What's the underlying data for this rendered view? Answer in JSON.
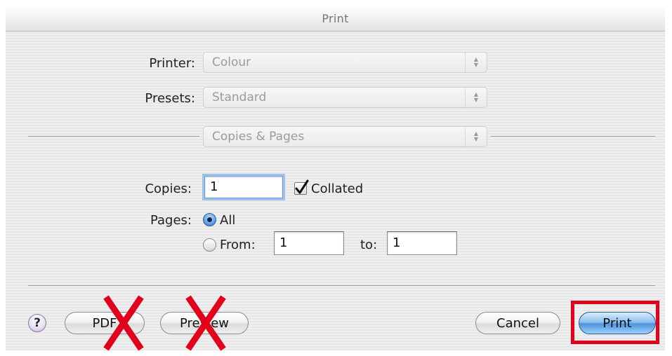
{
  "dialog": {
    "title": "Print"
  },
  "printer": {
    "label": "Printer:",
    "value": "Colour"
  },
  "presets": {
    "label": "Presets:",
    "value": "Standard"
  },
  "panel_selector": {
    "value": "Copies & Pages"
  },
  "copies": {
    "label": "Copies:",
    "value": "1",
    "collated_label": "Collated",
    "collated_checked": true
  },
  "pages": {
    "label": "Pages:",
    "all_label": "All",
    "all_selected": true,
    "from_label": "From:",
    "from_value": "1",
    "to_label": "to:",
    "to_value": "1"
  },
  "buttons": {
    "help": "?",
    "pdf": "PDF",
    "preview": "Preview",
    "cancel": "Cancel",
    "print": "Print"
  },
  "annotations": {
    "cross_color": "#e3001b",
    "highlight_color": "#e3001b"
  }
}
